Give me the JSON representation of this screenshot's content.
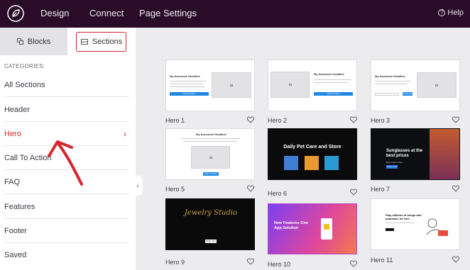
{
  "topbar": {
    "nav": [
      "Design",
      "Connect",
      "Page Settings"
    ],
    "help": "Help",
    "bg": "#2a0c28"
  },
  "sidebar": {
    "tabs": {
      "blocks": "Blocks",
      "sections": "Sections"
    },
    "categories_label": "CATEGORIES:",
    "categories": [
      "All Sections",
      "Header",
      "Hero",
      "Call To Action",
      "FAQ",
      "Features",
      "Footer",
      "Saved"
    ],
    "active_category": "Hero",
    "accent": "#d8252e"
  },
  "templates": [
    {
      "label": "Hero 1",
      "headline": "My Awesome Headline",
      "button": "Call To Action"
    },
    {
      "label": "Hero 2",
      "headline": "My Awesome Headline",
      "button": "Call To Action"
    },
    {
      "label": "Hero 3",
      "headline": "My Awesome Headline",
      "button": "Subscribe"
    },
    {
      "label": "Hero 5",
      "headline": "My Awesome Headline",
      "button": "Call To Action"
    },
    {
      "label": "Hero 6",
      "headline": "Daily Pet Care and Store"
    },
    {
      "label": "Hero 7",
      "headline": "Sunglasses at the best prices",
      "subhead": "Buy 1 Get 1 Free",
      "button": "Shop Now"
    },
    {
      "label": "Hero 9",
      "headline": "Jewelry Studio",
      "button": "Shop Now"
    },
    {
      "label": "Hero 10",
      "headline": "New Features One App Solution"
    },
    {
      "label": "Hero 11",
      "headline": "Play millions of songs and podcasts, for free."
    }
  ]
}
